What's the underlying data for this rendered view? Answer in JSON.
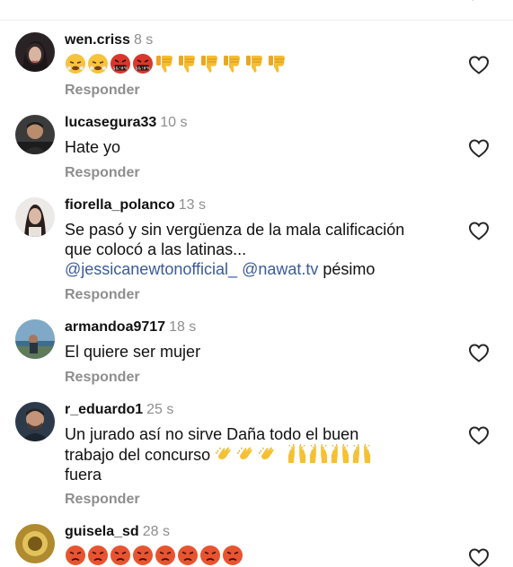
{
  "reply_label": "Responder",
  "colors": {
    "username": "#111111",
    "time": "#8e8e8e",
    "mention": "#3b5a9a",
    "reply": "#8e8e8e"
  },
  "comments": [
    {
      "username": "wen.criss",
      "time": "8 s",
      "text": "",
      "emojis": [
        "face-with-steam-icon",
        "face-with-steam-icon",
        "cursing-face-icon",
        "cursing-face-icon",
        "thumbs-down-icon",
        "thumbs-down-icon",
        "thumbs-down-icon",
        "thumbs-down-icon",
        "thumbs-down-icon",
        "thumbs-down-icon"
      ]
    },
    {
      "username": "lucasegura33",
      "time": "10 s",
      "text": "Hate yo"
    },
    {
      "username": "fiorella_polanco",
      "time": "13 s",
      "text_line1": "Se pasó y sin vergüenza de la mala calificación",
      "text_line2": "que colocó a las latinas...",
      "mention1": "@jessicanewtonofficial_",
      "mention2": "@nawat.tv",
      "tail": "pésimo"
    },
    {
      "username": "armandoa9717",
      "time": "18 s",
      "text": "El quiere ser mujer"
    },
    {
      "username": "r_eduardo1",
      "time": "25 s",
      "text_line1": "Un jurado así no sirve Daña todo el buen",
      "text_line2": "trabajo del concurso",
      "text_line3": "fuera",
      "emojis": [
        "clapping-hands-icon",
        "clapping-hands-icon",
        "clapping-hands-icon",
        "raising-hands-icon",
        "raising-hands-icon",
        "raising-hands-icon",
        "raising-hands-icon"
      ]
    },
    {
      "username": "guisela_sd",
      "time": "28 s",
      "emojis": [
        "angry-face-icon",
        "angry-face-icon",
        "angry-face-icon",
        "angry-face-icon",
        "angry-face-icon",
        "angry-face-icon",
        "angry-face-icon",
        "angry-face-icon"
      ]
    }
  ]
}
